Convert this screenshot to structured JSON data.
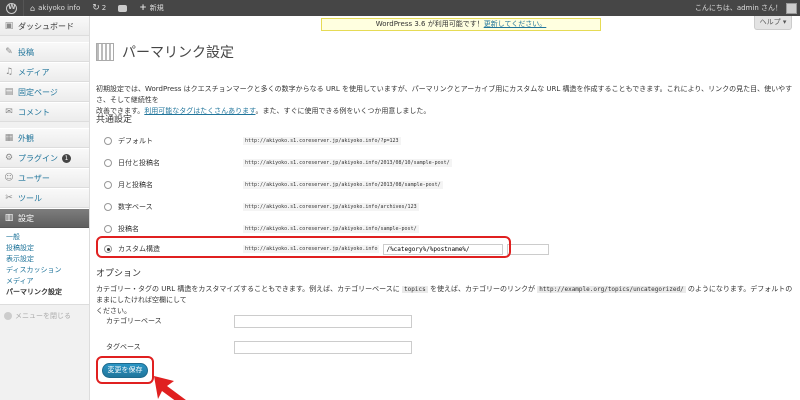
{
  "adminbar": {
    "site_name": "akiyoko info",
    "updates": "2",
    "new_label": "新規",
    "greeting": "こんにちは、admin さん！"
  },
  "sidebar": {
    "dashboard": "ダッシュボード",
    "items": [
      "投稿",
      "メディア",
      "固定ページ",
      "コメント",
      "外観",
      "プラグイン",
      "ユーザー",
      "ツール",
      "設定"
    ],
    "plugin_badge": "1",
    "submenu": [
      "一般",
      "投稿設定",
      "表示設定",
      "ディスカッション",
      "メディア",
      "パーマリンク設定"
    ],
    "collapse": "メニューを閉じる"
  },
  "notice": {
    "text": "WordPress 3.6 が利用可能です！",
    "link": "更新してください。"
  },
  "help_label": "ヘルプ",
  "page_title": "パーマリンク設定",
  "intro": {
    "text1": "初期設定では、WordPress はクエスチョンマークと多くの数字からなる URL を使用していますが、パーマリンクとアーカイブ用にカスタムな URL 構造を作成することもできます。これにより、リンクの見た目、使いやすさ、そして継続性を",
    "text2": "改善できます。",
    "link": "利用可能なタグはたくさんあります",
    "text3": "。また、すぐに使用できる例をいくつか用意しました。"
  },
  "common_title": "共通設定",
  "options": [
    {
      "label": "デフォルト",
      "url": "http://akiyoko.s1.coreserver.jp/akiyoko.info/?p=123",
      "checked": false
    },
    {
      "label": "日付と投稿名",
      "url": "http://akiyoko.s1.coreserver.jp/akiyoko.info/2013/08/10/sample-post/",
      "checked": false
    },
    {
      "label": "月と投稿名",
      "url": "http://akiyoko.s1.coreserver.jp/akiyoko.info/2013/08/sample-post/",
      "checked": false
    },
    {
      "label": "数字ベース",
      "url": "http://akiyoko.s1.coreserver.jp/akiyoko.info/archives/123",
      "checked": false
    },
    {
      "label": "投稿名",
      "url": "http://akiyoko.s1.coreserver.jp/akiyoko.info/sample-post/",
      "checked": false
    }
  ],
  "custom": {
    "label": "カスタム構造",
    "url": "http://akiyoko.s1.coreserver.jp/akiyoko.info",
    "value": "/%category%/%postname%/"
  },
  "optional": {
    "title": "オプション",
    "desc1": "カテゴリー・タグの URL 構造をカスタマイズすることもできます。例えば、カテゴリーベースに",
    "code1": "topics",
    "desc2": "を使えば、カテゴリーのリンクが",
    "code2": "http://example.org/topics/uncategorized/",
    "desc3": "のようになります。デフォルトのままにしたければ空欄にして",
    "desc4": "ください。",
    "category_base": "カテゴリーベース",
    "tag_base": "タグベース"
  },
  "save_label": "変更を保存"
}
